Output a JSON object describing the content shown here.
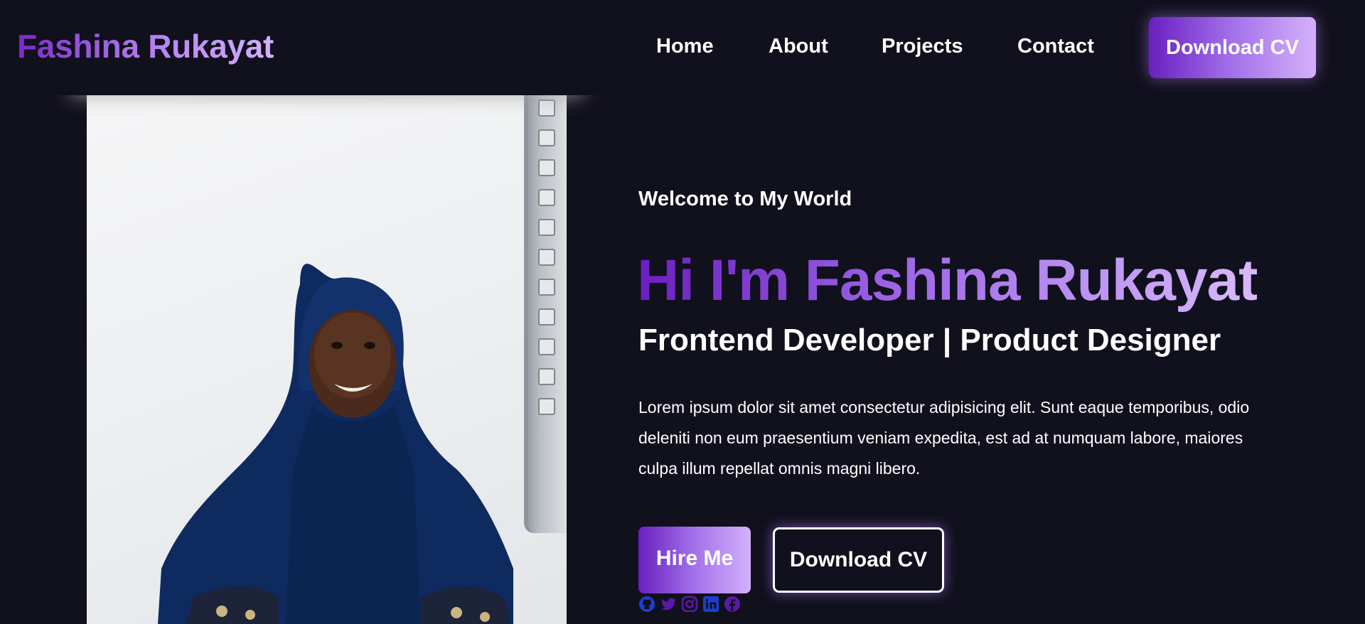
{
  "nav": {
    "logo": "Fashina Rukayat",
    "links": [
      "Home",
      "About",
      "Projects",
      "Contact"
    ],
    "cta": "Download CV"
  },
  "hero": {
    "welcome": "Welcome to My World",
    "headline": "Hi I'm Fashina Rukayat",
    "subtitle": "Frontend Developer | Product Designer",
    "intro": "Lorem ipsum dolor sit amet consectetur adipisicing elit. Sunt eaque temporibus, odio deleniti non eum praesentium veniam expedita, est ad at numquam labore, maiores culpa illum repellat omnis magni libero.",
    "primary_button": "Hire Me",
    "secondary_button": "Download CV",
    "socials": [
      "github-icon",
      "twitter-icon",
      "instagram-icon",
      "linkedin-icon",
      "facebook-icon"
    ]
  },
  "colors": {
    "background": "#11101d",
    "accent_start": "#6a1fc0",
    "accent_end": "#d4b0fb",
    "icon_blue": "#1c3fd0",
    "icon_purple": "#5a1aa8"
  }
}
